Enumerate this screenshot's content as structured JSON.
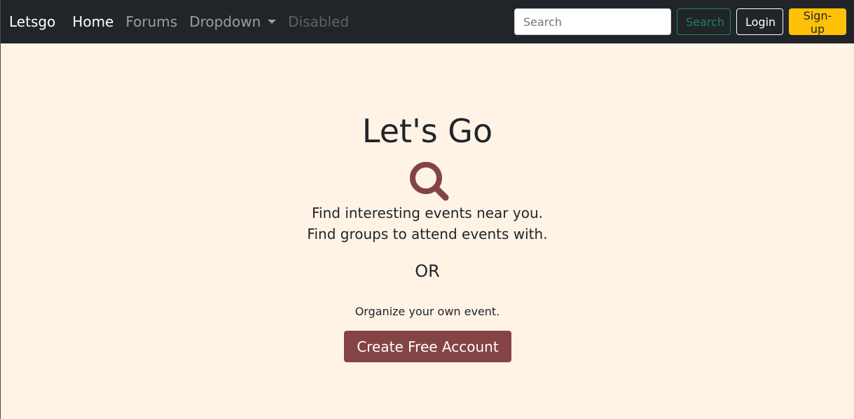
{
  "navbar": {
    "brand": "Letsgo",
    "links": [
      {
        "label": "Home"
      },
      {
        "label": "Forums"
      },
      {
        "label": "Dropdown"
      },
      {
        "label": "Disabled"
      }
    ],
    "search": {
      "placeholder": "Search",
      "value": "",
      "button_label": "Search"
    },
    "login_label": "Login",
    "signup_label": "Sign-up"
  },
  "hero": {
    "title": "Let's Go",
    "icon": "search-icon",
    "line1": "Find interesting events near you.",
    "line2": "Find groups to attend events with.",
    "or": "OR",
    "organize": "Organize your own event.",
    "cta_label": "Create Free Account"
  },
  "colors": {
    "navbar_bg": "#212529",
    "page_bg": "#fff3e6",
    "accent": "#844344",
    "search_button": "#198754",
    "signup_button": "#ffc107"
  }
}
